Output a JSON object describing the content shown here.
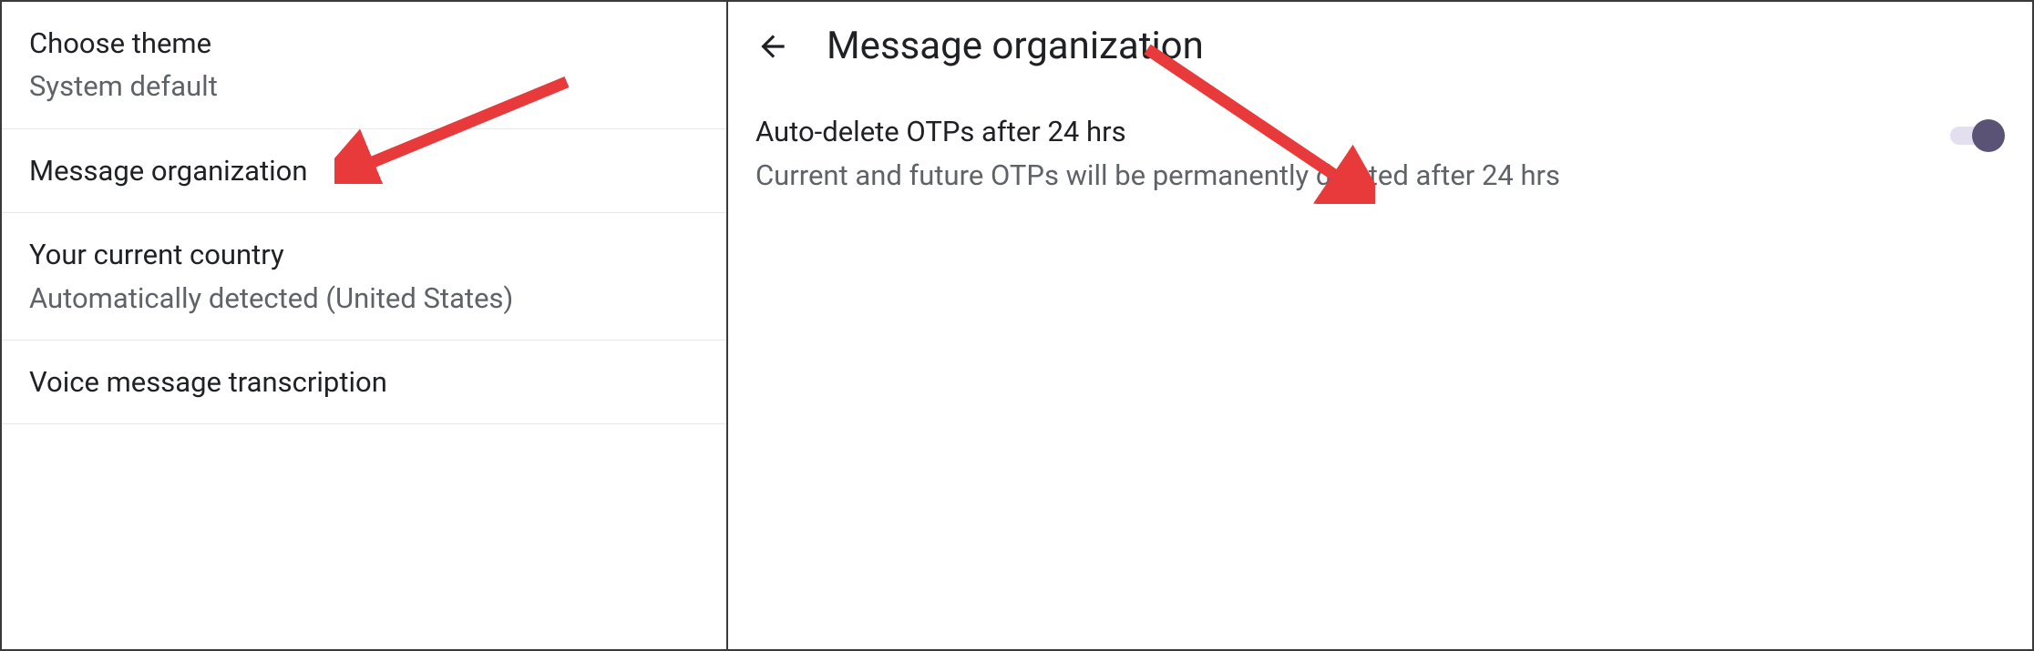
{
  "left_panel": {
    "items": [
      {
        "title": "Choose theme",
        "subtitle": "System default"
      },
      {
        "title": "Message organization",
        "subtitle": null
      },
      {
        "title": "Your current country",
        "subtitle": "Automatically detected (United States)"
      },
      {
        "title": "Voice message transcription",
        "subtitle": null
      }
    ]
  },
  "right_panel": {
    "header_title": "Message organization",
    "option": {
      "title": "Auto-delete OTPs after 24 hrs",
      "subtitle": "Current and future OTPs will be permanently deleted after 24 hrs",
      "toggle_on": true
    }
  },
  "annotations": {
    "arrow_color": "#e83a3a"
  }
}
